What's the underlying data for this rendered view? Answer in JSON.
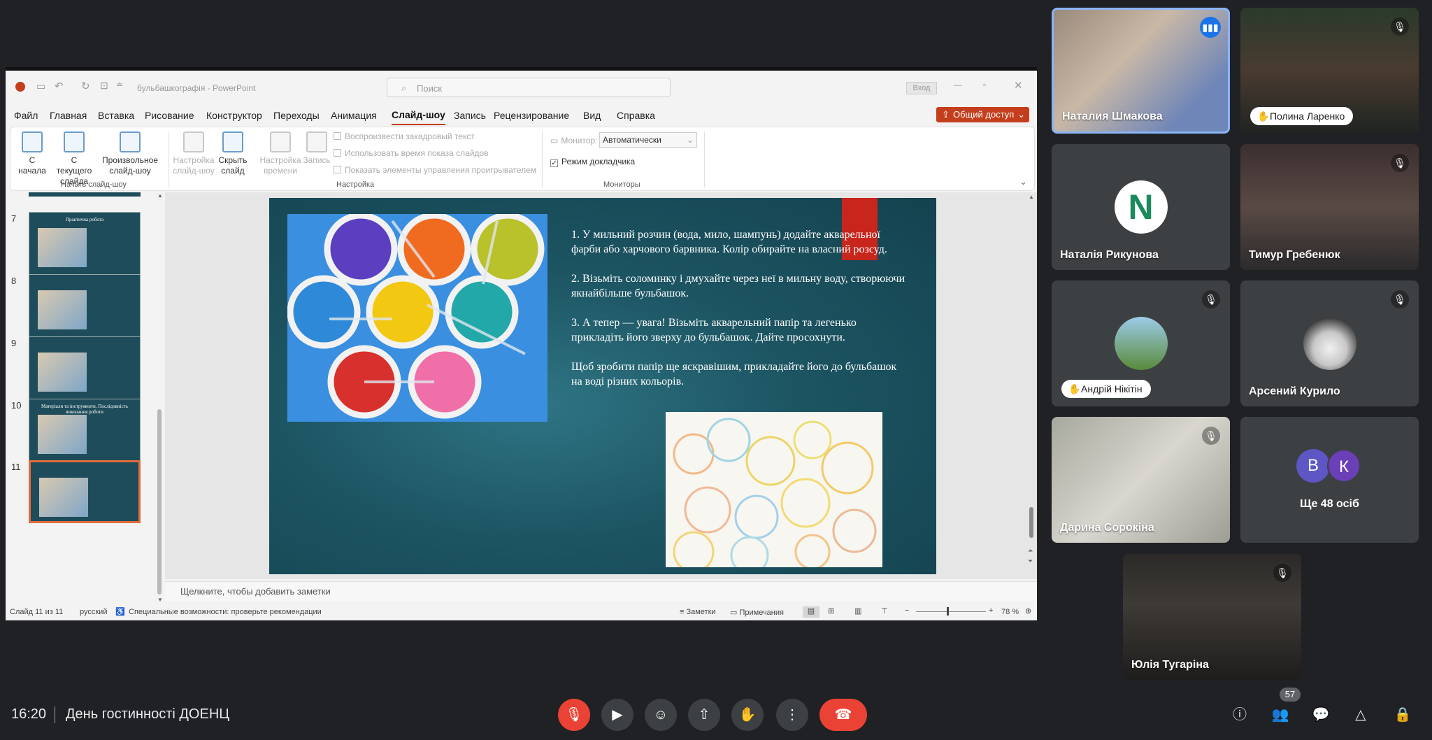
{
  "meeting": {
    "time": "16:20",
    "title": "День гостинності ДОЕНЦ",
    "participants_badge": "57",
    "others_label": "Ще 48 осіб",
    "others_initials": [
      "В",
      "К"
    ],
    "participants": [
      {
        "name": "Наталия Шмакова"
      },
      {
        "name": "Полина Ларенко"
      },
      {
        "name": "Наталія Рикунова"
      },
      {
        "name": "Тимур Гребенюк"
      },
      {
        "name": "Андрій Нікітін"
      },
      {
        "name": "Арсений Курило"
      },
      {
        "name": "Дарина Сорокіна"
      },
      {
        "name": "Юлія Тугаріна"
      }
    ],
    "colors": {
      "bg": "#202124",
      "end_call": "#ea4335",
      "active_speaker": "#8ab4f8"
    }
  },
  "powerpoint": {
    "filename": "бульбашкографія",
    "app": "PowerPoint",
    "search_placeholder": "Поиск",
    "signin": "Вход",
    "share": "Общий доступ",
    "menu": [
      "Файл",
      "Главная",
      "Вставка",
      "Рисование",
      "Конструктор",
      "Переходы",
      "Анимация",
      "Слайд-шоу",
      "Запись",
      "Рецензирование",
      "Вид",
      "Справка"
    ],
    "active_menu": "Слайд-шоу",
    "ribbon": {
      "from_start": "С начала",
      "from_current": "С текущего слайда",
      "custom": "Произвольное слайд-шоу",
      "group_start": "Начать слайд-шоу",
      "setup_show": "Настройка слайд-шоу",
      "hide_slide": "Скрыть слайд",
      "rehearse": "Настройка времени",
      "record": "Запись",
      "chk_narration": "Воспроизвести закадровый текст",
      "chk_timings": "Использовать время показа слайдов",
      "chk_controls": "Показать элементы управления проигрывателем",
      "group_setup": "Настройка",
      "monitor_label": "Монитор:",
      "monitor_value": "Автоматически",
      "presenter_view": "Режим докладчика",
      "group_monitors": "Мониторы"
    },
    "thumbnails": [
      {
        "num": "7",
        "title": "Практична робота"
      },
      {
        "num": "8",
        "title": ""
      },
      {
        "num": "9",
        "title": ""
      },
      {
        "num": "10",
        "title": "Матеріали та інструменти. Послідовність виконання роботи"
      },
      {
        "num": "11",
        "title": ""
      }
    ],
    "slide": {
      "p1": "1. У мильний розчин (вода, мило, шампунь) додайте акварельної фарби або харчового барвника. Колір обирайте на власний розсуд.",
      "p2": "2. Візьміть соломинку і дмухайте через неї в мильну воду, створюючи якнайбільше бульбашок.",
      "p3": "3. А тепер — увага! Візьміть акварельний папір та легенько прикладіть його зверху до бульбашок. Дайте просохнути.",
      "p4": "Щоб зробити папір ще яскравішим, прикладайте його до бульбашок на воді різних кольорів."
    },
    "notes_placeholder": "Щелкните, чтобы добавить заметки",
    "status": {
      "slide_of": "Слайд 11 из 11",
      "language": "русский",
      "accessibility": "Специальные возможности: проверьте рекомендации",
      "notes": "Заметки",
      "comments": "Примечания",
      "zoom": "78 %"
    },
    "accent": "#c43e1c"
  }
}
